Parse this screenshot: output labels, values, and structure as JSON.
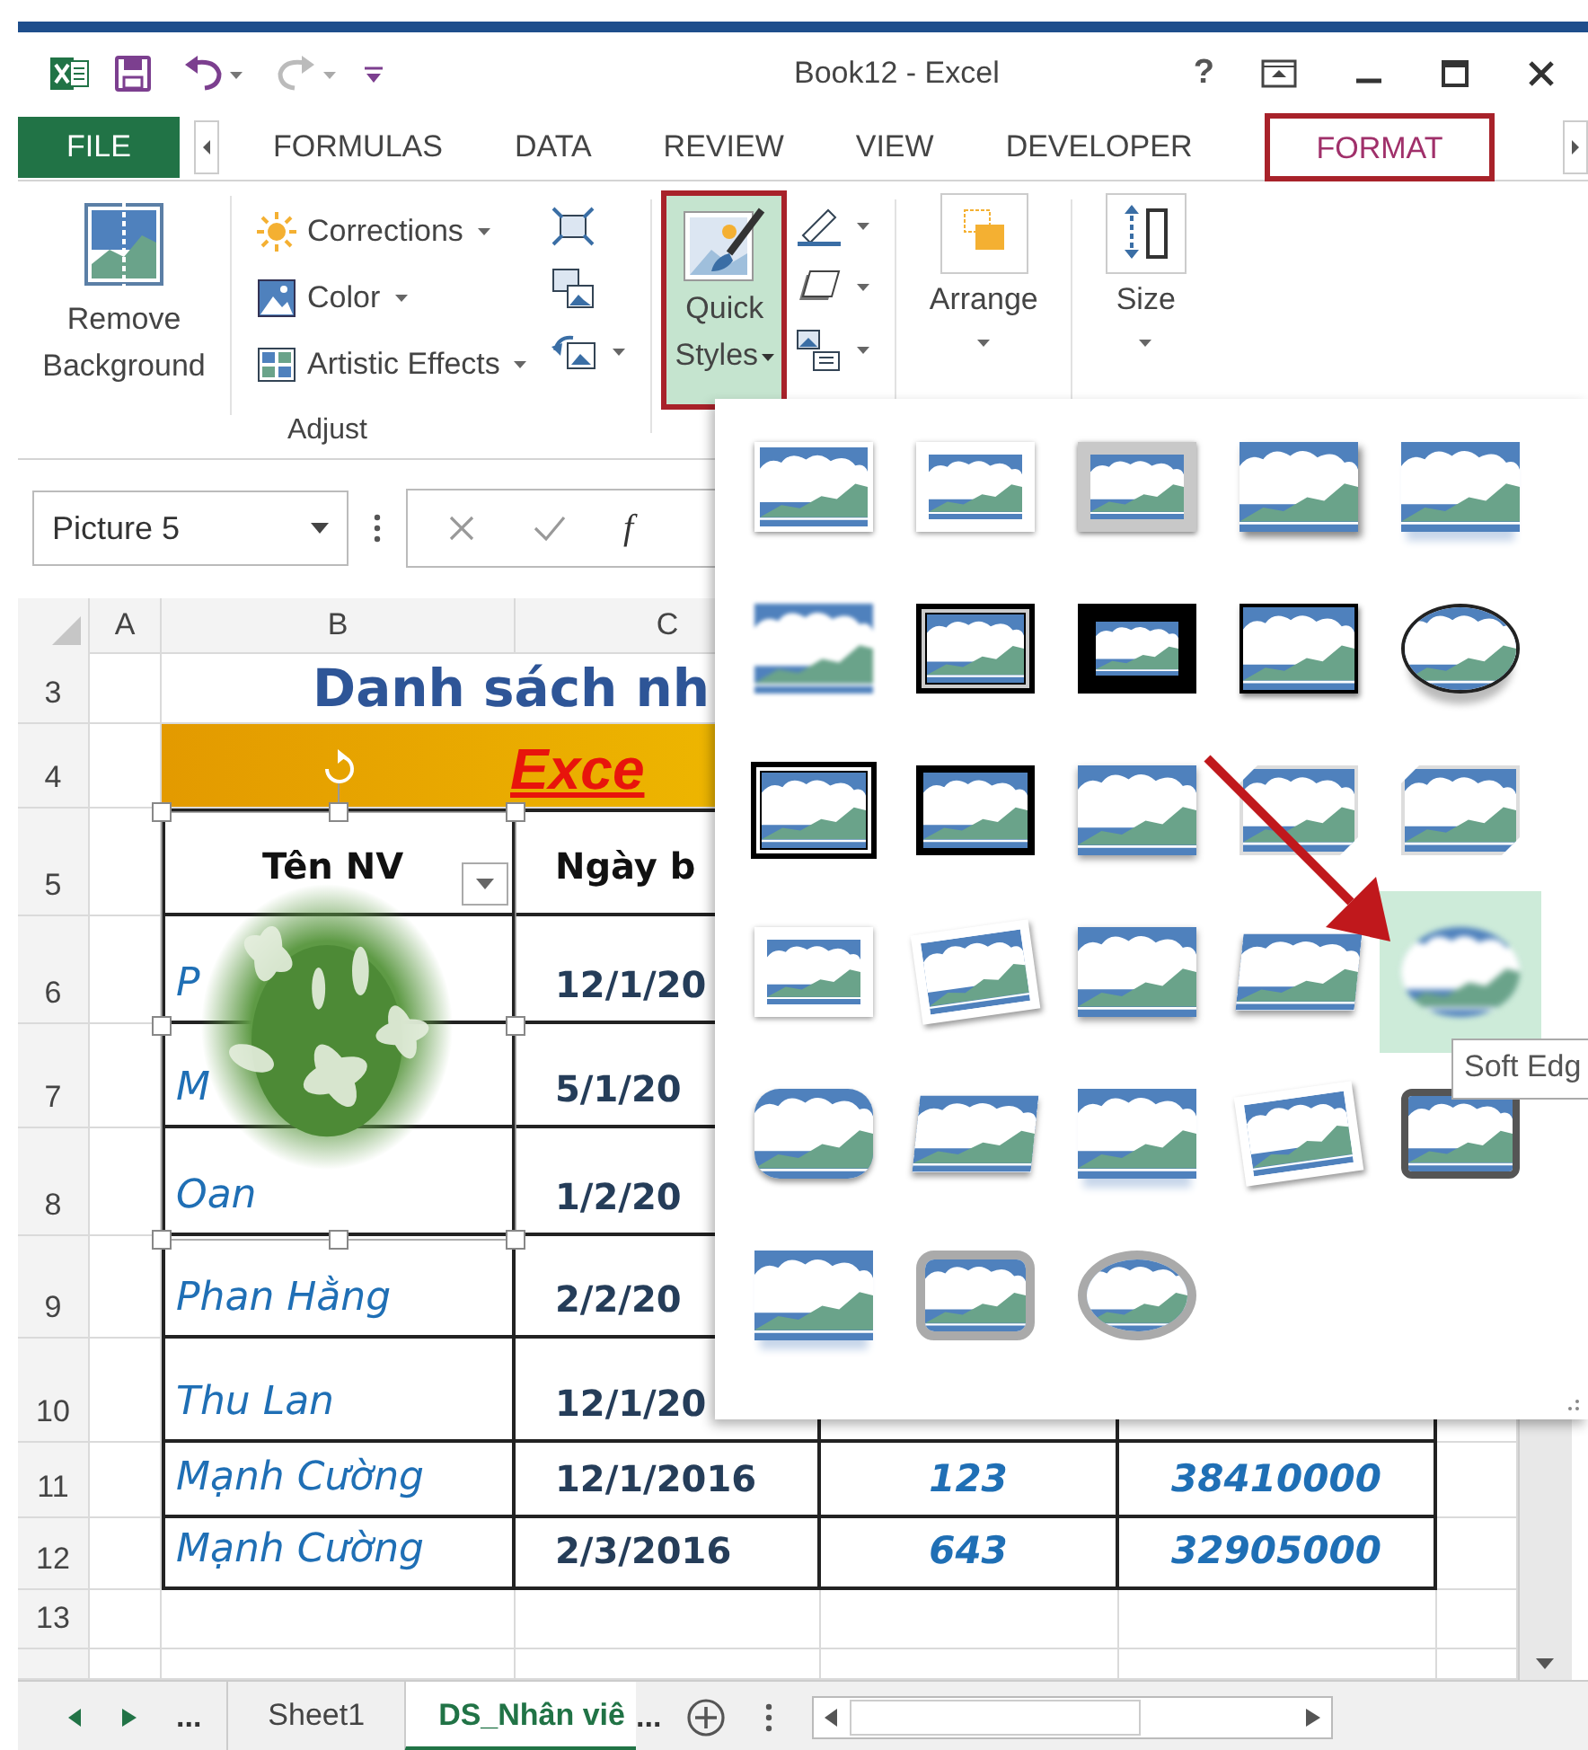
{
  "window": {
    "title": "Book12 - Excel",
    "help": "?"
  },
  "quick_access": [
    {
      "kind": "save",
      "disabled": false
    },
    {
      "kind": "undo",
      "disabled": false
    },
    {
      "kind": "redo",
      "disabled": true
    },
    {
      "kind": "customize",
      "disabled": false
    }
  ],
  "tabs": [
    {
      "label": "FILE",
      "kind": "file",
      "selected": false,
      "annotated": false
    },
    {
      "label": "FORMULAS",
      "kind": "tab",
      "selected": false,
      "annotated": false
    },
    {
      "label": "DATA",
      "kind": "tab",
      "selected": false,
      "annotated": false
    },
    {
      "label": "REVIEW",
      "kind": "tab",
      "selected": false,
      "annotated": false
    },
    {
      "label": "VIEW",
      "kind": "tab",
      "selected": false,
      "annotated": false
    },
    {
      "label": "DEVELOPER",
      "kind": "tab",
      "selected": false,
      "annotated": false
    },
    {
      "label": "FORMAT",
      "kind": "tab",
      "selected": true,
      "annotated": true
    }
  ],
  "adjust_group": {
    "label": "Adjust",
    "remove_background": "Remove Background",
    "menu_buttons": [
      {
        "label": "Corrections",
        "kind": "corrections"
      },
      {
        "label": "Color",
        "kind": "color"
      },
      {
        "label": "Artistic Effects",
        "kind": "artistic"
      }
    ]
  },
  "quick_styles": {
    "label": "Quick Styles",
    "open": true,
    "annotated": true
  },
  "arrange": {
    "label": "Arrange"
  },
  "size": {
    "label": "Size"
  },
  "formula_bar": {
    "name_box": "Picture 5",
    "function_label": "f"
  },
  "sheet": {
    "columns": [
      "A",
      "B",
      "C"
    ],
    "rows": [
      {
        "number": "3",
        "kind": "title",
        "text": "Danh sách nh"
      },
      {
        "number": "4",
        "kind": "banner",
        "text": "Exce"
      },
      {
        "number": "5",
        "kind": "header",
        "cells": [
          "Tên NV",
          "Ngày b"
        ]
      },
      {
        "number": "6",
        "kind": "data",
        "cells": [
          "P",
          "12/1/20"
        ]
      },
      {
        "number": "7",
        "kind": "data",
        "cells": [
          "M",
          "5/1/20"
        ]
      },
      {
        "number": "8",
        "kind": "data",
        "cells": [
          "Oan",
          "1/2/20"
        ]
      },
      {
        "number": "9",
        "kind": "data",
        "cells": [
          "Phan Hằng",
          "2/2/20"
        ]
      },
      {
        "number": "10",
        "kind": "data",
        "cells": [
          "Thu Lan",
          "12/1/20"
        ]
      },
      {
        "number": "11",
        "kind": "data",
        "cells": [
          "Mạnh Cường",
          "12/1/2016",
          "123",
          "38410000"
        ]
      },
      {
        "number": "12",
        "kind": "data",
        "cells": [
          "Mạnh Cường",
          "2/3/2016",
          "643",
          "32905000"
        ]
      },
      {
        "number": "13",
        "kind": "empty"
      },
      {
        "kind": "empty"
      }
    ]
  },
  "gallery": {
    "items": [
      {
        "kind": "plain-frame",
        "selected": false
      },
      {
        "kind": "white-frame",
        "selected": false
      },
      {
        "kind": "gray-frame",
        "selected": false
      },
      {
        "kind": "shadow",
        "selected": false
      },
      {
        "kind": "reflect",
        "selected": false
      },
      {
        "kind": "soft-rect",
        "selected": false
      },
      {
        "kind": "double-black",
        "selected": false
      },
      {
        "kind": "thick-black",
        "selected": false
      },
      {
        "kind": "thin-black",
        "selected": false
      },
      {
        "kind": "oval",
        "selected": false
      },
      {
        "kind": "compound-black",
        "selected": false
      },
      {
        "kind": "center-shadow",
        "selected": false
      },
      {
        "kind": "moderate",
        "selected": false
      },
      {
        "kind": "snip",
        "selected": false
      },
      {
        "kind": "snip",
        "selected": false
      },
      {
        "kind": "white-frame",
        "selected": false
      },
      {
        "kind": "rotated",
        "selected": false
      },
      {
        "kind": "moderate",
        "selected": false
      },
      {
        "kind": "perspective",
        "selected": false
      },
      {
        "kind": "soft-oval",
        "selected": true
      },
      {
        "kind": "rounded",
        "selected": false
      },
      {
        "kind": "perspective",
        "selected": false
      },
      {
        "kind": "reflect",
        "selected": false
      },
      {
        "kind": "rotated",
        "selected": false
      },
      {
        "kind": "dark-rounded",
        "selected": false
      },
      {
        "kind": "reflect",
        "selected": false
      },
      {
        "kind": "gray-rounded",
        "selected": false
      },
      {
        "kind": "gray-oval",
        "selected": false
      }
    ],
    "tooltip": "Soft Edg"
  },
  "sheet_tabs": {
    "more_left": "...",
    "tabs": [
      {
        "label": "Sheet1",
        "selected": false
      },
      {
        "label": "DS_Nhân viê",
        "selected": true
      }
    ],
    "more_right": "..."
  }
}
